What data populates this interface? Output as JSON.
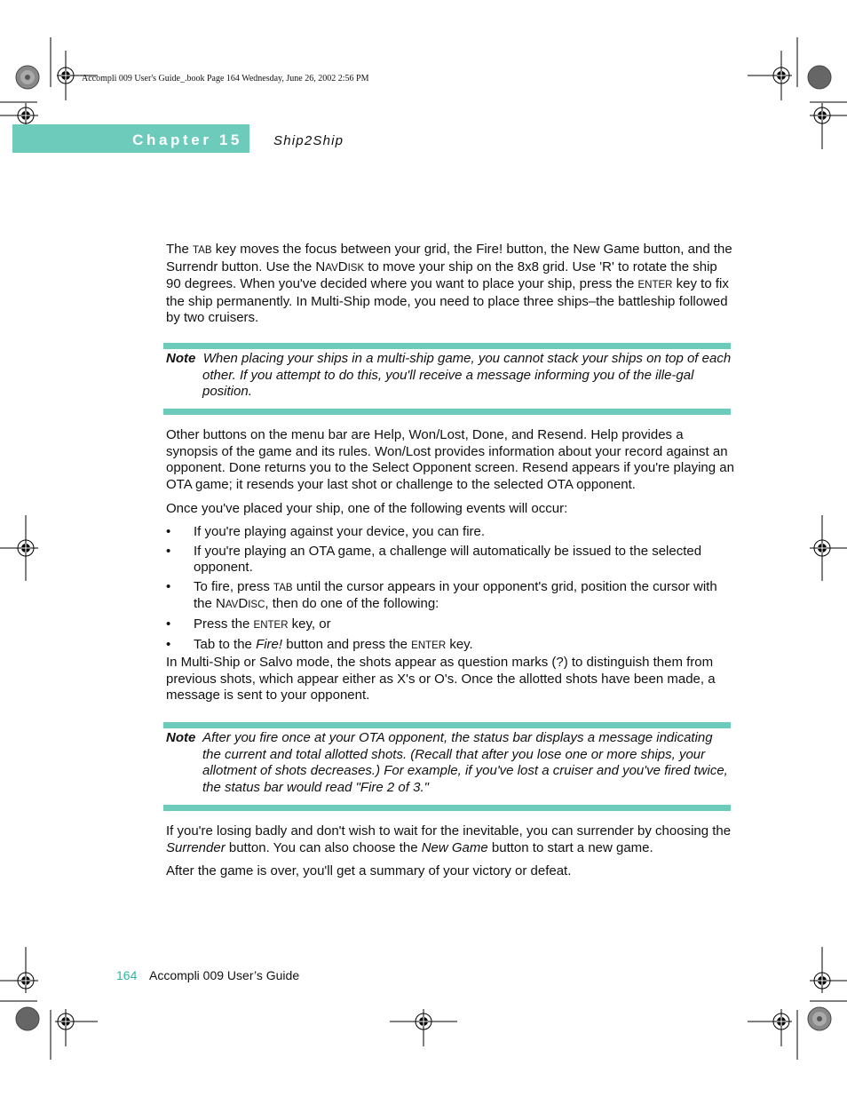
{
  "slug_line": "Accompli 009 User's Guide_.book  Page 164  Wednesday, June 26, 2002  2:56 PM",
  "header": {
    "chapter_label": "Chapter 15",
    "chapter_title": "Ship2Ship"
  },
  "paragraphs": {
    "p1": {
      "a": "The ",
      "tab": "TAB",
      "b": " key moves the focus between your grid, the Fire! button, the New Game button, and the Surrendr button. Use the N",
      "nav1": "AV",
      "c": "D",
      "nav2": "ISK",
      "d": " to move your ship on the 8x8 grid. Use 'R' to rotate the ship 90 degrees. When you've decided where you want to place your ship, press the ",
      "enter": "ENTER",
      "e": " key to fix the ship permanently. In Multi-Ship mode, you need to place three ships–the battleship followed by two cruisers."
    },
    "p2": "Other buttons on the menu bar are Help, Won/Lost, Done, and Resend. Help provides a synopsis of the game and its rules. Won/Lost provides information about your record against an opponent. Done returns you to the Select Opponent screen. Resend appears if you're playing an OTA game; it resends your last shot or challenge to the selected OTA opponent.",
    "p3": "Once you've placed your ship, one of the following events will occur:",
    "p4": "In Multi-Ship or Salvo mode, the shots appear as question marks (?) to distinguish them from previous shots, which appear either as X's or O's. Once the allotted shots have been made, a message is sent to your opponent.",
    "p5": {
      "a": "If you're losing badly and don't wish to wait for the inevitable, you can surrender by choosing the ",
      "surrender": "Surrender",
      "b": " button. You can also choose the ",
      "new_game": "New Game",
      "c": " button to start a new game."
    },
    "p6": "After the game is over, you'll get a summary of your victory or defeat."
  },
  "notes": [
    {
      "label": "Note",
      "text": "When placing your ships in a multi-ship game, you cannot stack your ships on top of each other. If you attempt to do this, you'll receive a message informing you of the ille-gal position."
    },
    {
      "label": "Note",
      "text": "After you fire once at your OTA opponent, the status bar displays a message indicating the current and total allotted shots. (Recall that after you lose one or more ships, your allotment of shots decreases.) For example, if you've lost a cruiser and you've fired twice, the status bar would read \"Fire 2 of 3.\""
    }
  ],
  "bullets": {
    "symbol": "•",
    "b1": "If you're playing against your device, you can fire.",
    "b2": "If you're playing an OTA game, a challenge will automatically be issued to the selected opponent.",
    "b3": {
      "a": "To fire, press ",
      "tab": "TAB",
      "b": " until the cursor appears in your opponent's grid, position the cursor with the N",
      "nav1": "AV",
      "c": "D",
      "nav2": "ISC",
      "d": ", then do one of the following:"
    },
    "b4": {
      "a": "Press the ",
      "enter": "ENTER",
      "b": " key, or"
    },
    "b5": {
      "a": "Tab to the ",
      "fire": "Fire!",
      "b": " button and press the ",
      "enter": "ENTER",
      "c": " key."
    }
  },
  "footer": {
    "page_number": "164",
    "book_title": "Accompli 009 User’s Guide"
  },
  "colors": {
    "accent": "#6ccbbb",
    "page_number": "#2fb5a0"
  }
}
